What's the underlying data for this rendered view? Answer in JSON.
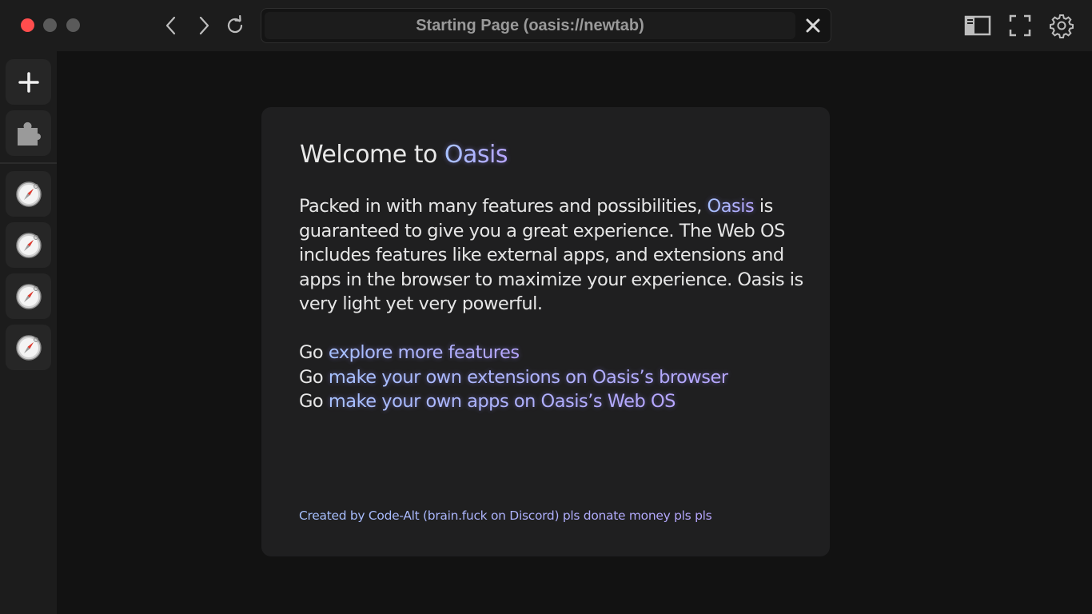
{
  "window": {
    "traffic_lights": [
      "close",
      "minimize",
      "maximize"
    ],
    "colors": {
      "close": "#ff4d4d",
      "inactive": "#5a5a5a"
    }
  },
  "nav": {
    "back_icon": "chevron-left-icon",
    "forward_icon": "chevron-right-icon",
    "reload_icon": "reload-icon"
  },
  "urlbar": {
    "value": "Starting Page (oasis://newtab)",
    "close_icon": "close-icon"
  },
  "toolbar_right": [
    "sidebar-toggle-icon",
    "fullscreen-icon",
    "gear-icon"
  ],
  "sidebar": {
    "top_buttons": [
      {
        "name": "new-tab",
        "icon": "plus-icon"
      },
      {
        "name": "extensions",
        "icon": "puzzle-icon"
      }
    ],
    "tabs": [
      {
        "icon": "compass-icon"
      },
      {
        "icon": "compass-icon"
      },
      {
        "icon": "compass-icon"
      },
      {
        "icon": "compass-icon"
      }
    ]
  },
  "card": {
    "title_prefix": "Welcome to ",
    "title_accent": "Oasis",
    "para_start": "Packed in with many features and possibilities, ",
    "para_accent": "Oasis",
    "para_rest": " is guaranteed to give you a great experience. The Web OS includes features like external apps, and extensions and apps in the browser to maximize your experience. Oasis is very light yet very powerful.",
    "links": [
      {
        "prefix": "Go ",
        "label": "explore more features"
      },
      {
        "prefix": "Go ",
        "label": "make your own extensions on Oasis’s browser"
      },
      {
        "prefix": "Go ",
        "label": "make your own apps on Oasis’s Web OS"
      }
    ],
    "footer": "Created by Code-Alt (brain.fuck on Discord) pls donate money pls pls"
  },
  "colors": {
    "accent_start": "#a7c2ff",
    "accent_end": "#b7a6ff",
    "background": "#121212",
    "panel": "#1c1c1c",
    "card": "#1f1f20"
  }
}
